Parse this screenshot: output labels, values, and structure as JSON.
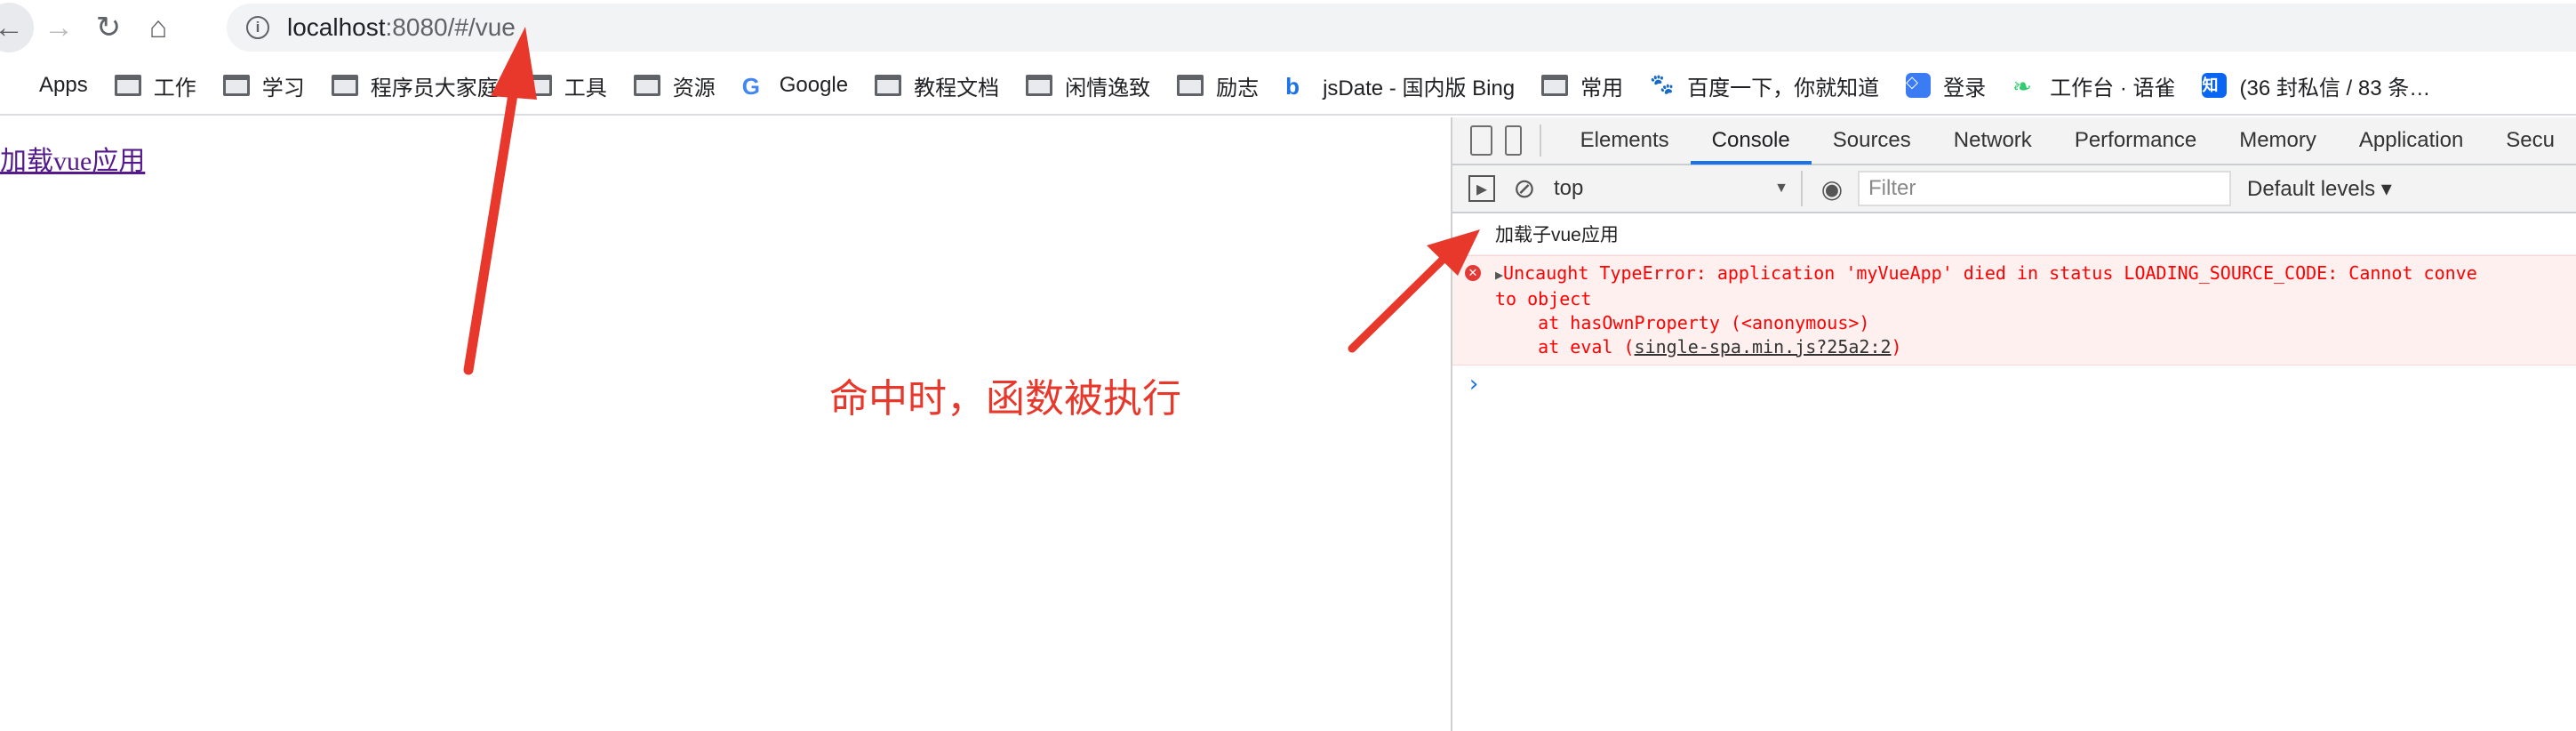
{
  "browser": {
    "url_host": "localhost",
    "url_rest": ":8080/#/vue",
    "bookmarks": [
      {
        "label": "Apps",
        "icon": "apps-grid-icon"
      },
      {
        "label": "工作",
        "icon": "folder-icon"
      },
      {
        "label": "学习",
        "icon": "folder-icon"
      },
      {
        "label": "程序员大家庭",
        "icon": "folder-icon"
      },
      {
        "label": "工具",
        "icon": "folder-icon"
      },
      {
        "label": "资源",
        "icon": "folder-icon"
      },
      {
        "label": "Google",
        "icon": "google-icon"
      },
      {
        "label": "教程文档",
        "icon": "folder-icon"
      },
      {
        "label": "闲情逸致",
        "icon": "folder-icon"
      },
      {
        "label": "励志",
        "icon": "folder-icon"
      },
      {
        "label": "jsDate - 国内版 Bing",
        "icon": "bing-icon"
      },
      {
        "label": "常用",
        "icon": "folder-icon"
      },
      {
        "label": "百度一下，你就知道",
        "icon": "baidu-icon"
      },
      {
        "label": "登录",
        "icon": "login-icon"
      },
      {
        "label": "工作台 · 语雀",
        "icon": "yuque-icon"
      },
      {
        "label": "(36 封私信 / 83 条…",
        "icon": "zhihu-icon"
      }
    ]
  },
  "page": {
    "link_text": "加载vue应用",
    "annotation": "命中时，函数被执行",
    "annotation_color": "#e8382c"
  },
  "devtools": {
    "tabs": [
      "Elements",
      "Console",
      "Sources",
      "Network",
      "Performance",
      "Memory",
      "Application",
      "Secu"
    ],
    "active_tab": "Console",
    "context": "top",
    "filter_placeholder": "Filter",
    "levels": "Default levels ▾",
    "log": "加载子vue应用",
    "error": {
      "line1": "Uncaught TypeError: application 'myVueApp' died in status LOADING_SOURCE_CODE: Cannot conve",
      "line2": "to object",
      "line3": "    at hasOwnProperty (<anonymous>)",
      "line4_prefix": "    at eval (",
      "line4_link": "single-spa.min.js?25a2:2",
      "line4_suffix": ")"
    },
    "prompt": "›"
  }
}
